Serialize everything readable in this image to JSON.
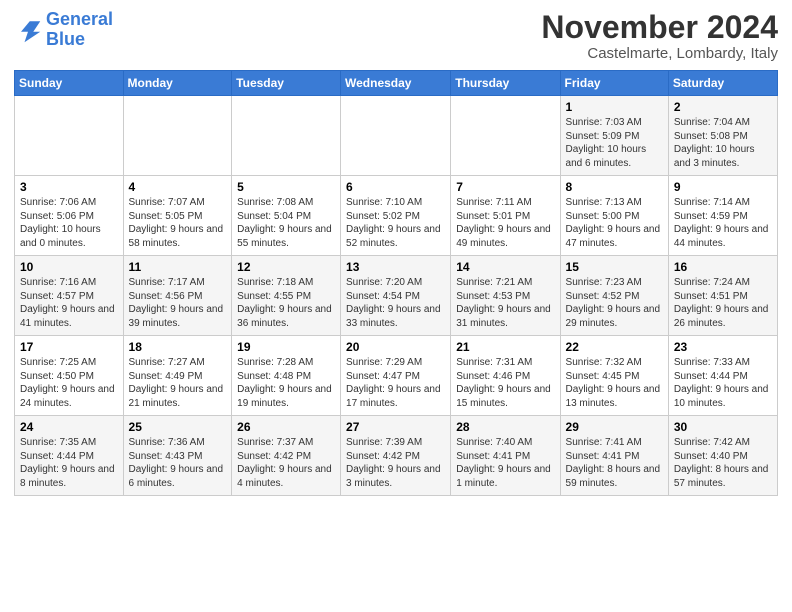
{
  "logo": {
    "line1": "General",
    "line2": "Blue"
  },
  "title": "November 2024",
  "subtitle": "Castelmarte, Lombardy, Italy",
  "days_of_week": [
    "Sunday",
    "Monday",
    "Tuesday",
    "Wednesday",
    "Thursday",
    "Friday",
    "Saturday"
  ],
  "weeks": [
    [
      {
        "day": "",
        "info": ""
      },
      {
        "day": "",
        "info": ""
      },
      {
        "day": "",
        "info": ""
      },
      {
        "day": "",
        "info": ""
      },
      {
        "day": "",
        "info": ""
      },
      {
        "day": "1",
        "info": "Sunrise: 7:03 AM\nSunset: 5:09 PM\nDaylight: 10 hours and 6 minutes."
      },
      {
        "day": "2",
        "info": "Sunrise: 7:04 AM\nSunset: 5:08 PM\nDaylight: 10 hours and 3 minutes."
      }
    ],
    [
      {
        "day": "3",
        "info": "Sunrise: 7:06 AM\nSunset: 5:06 PM\nDaylight: 10 hours and 0 minutes."
      },
      {
        "day": "4",
        "info": "Sunrise: 7:07 AM\nSunset: 5:05 PM\nDaylight: 9 hours and 58 minutes."
      },
      {
        "day": "5",
        "info": "Sunrise: 7:08 AM\nSunset: 5:04 PM\nDaylight: 9 hours and 55 minutes."
      },
      {
        "day": "6",
        "info": "Sunrise: 7:10 AM\nSunset: 5:02 PM\nDaylight: 9 hours and 52 minutes."
      },
      {
        "day": "7",
        "info": "Sunrise: 7:11 AM\nSunset: 5:01 PM\nDaylight: 9 hours and 49 minutes."
      },
      {
        "day": "8",
        "info": "Sunrise: 7:13 AM\nSunset: 5:00 PM\nDaylight: 9 hours and 47 minutes."
      },
      {
        "day": "9",
        "info": "Sunrise: 7:14 AM\nSunset: 4:59 PM\nDaylight: 9 hours and 44 minutes."
      }
    ],
    [
      {
        "day": "10",
        "info": "Sunrise: 7:16 AM\nSunset: 4:57 PM\nDaylight: 9 hours and 41 minutes."
      },
      {
        "day": "11",
        "info": "Sunrise: 7:17 AM\nSunset: 4:56 PM\nDaylight: 9 hours and 39 minutes."
      },
      {
        "day": "12",
        "info": "Sunrise: 7:18 AM\nSunset: 4:55 PM\nDaylight: 9 hours and 36 minutes."
      },
      {
        "day": "13",
        "info": "Sunrise: 7:20 AM\nSunset: 4:54 PM\nDaylight: 9 hours and 33 minutes."
      },
      {
        "day": "14",
        "info": "Sunrise: 7:21 AM\nSunset: 4:53 PM\nDaylight: 9 hours and 31 minutes."
      },
      {
        "day": "15",
        "info": "Sunrise: 7:23 AM\nSunset: 4:52 PM\nDaylight: 9 hours and 29 minutes."
      },
      {
        "day": "16",
        "info": "Sunrise: 7:24 AM\nSunset: 4:51 PM\nDaylight: 9 hours and 26 minutes."
      }
    ],
    [
      {
        "day": "17",
        "info": "Sunrise: 7:25 AM\nSunset: 4:50 PM\nDaylight: 9 hours and 24 minutes."
      },
      {
        "day": "18",
        "info": "Sunrise: 7:27 AM\nSunset: 4:49 PM\nDaylight: 9 hours and 21 minutes."
      },
      {
        "day": "19",
        "info": "Sunrise: 7:28 AM\nSunset: 4:48 PM\nDaylight: 9 hours and 19 minutes."
      },
      {
        "day": "20",
        "info": "Sunrise: 7:29 AM\nSunset: 4:47 PM\nDaylight: 9 hours and 17 minutes."
      },
      {
        "day": "21",
        "info": "Sunrise: 7:31 AM\nSunset: 4:46 PM\nDaylight: 9 hours and 15 minutes."
      },
      {
        "day": "22",
        "info": "Sunrise: 7:32 AM\nSunset: 4:45 PM\nDaylight: 9 hours and 13 minutes."
      },
      {
        "day": "23",
        "info": "Sunrise: 7:33 AM\nSunset: 4:44 PM\nDaylight: 9 hours and 10 minutes."
      }
    ],
    [
      {
        "day": "24",
        "info": "Sunrise: 7:35 AM\nSunset: 4:44 PM\nDaylight: 9 hours and 8 minutes."
      },
      {
        "day": "25",
        "info": "Sunrise: 7:36 AM\nSunset: 4:43 PM\nDaylight: 9 hours and 6 minutes."
      },
      {
        "day": "26",
        "info": "Sunrise: 7:37 AM\nSunset: 4:42 PM\nDaylight: 9 hours and 4 minutes."
      },
      {
        "day": "27",
        "info": "Sunrise: 7:39 AM\nSunset: 4:42 PM\nDaylight: 9 hours and 3 minutes."
      },
      {
        "day": "28",
        "info": "Sunrise: 7:40 AM\nSunset: 4:41 PM\nDaylight: 9 hours and 1 minute."
      },
      {
        "day": "29",
        "info": "Sunrise: 7:41 AM\nSunset: 4:41 PM\nDaylight: 8 hours and 59 minutes."
      },
      {
        "day": "30",
        "info": "Sunrise: 7:42 AM\nSunset: 4:40 PM\nDaylight: 8 hours and 57 minutes."
      }
    ]
  ]
}
